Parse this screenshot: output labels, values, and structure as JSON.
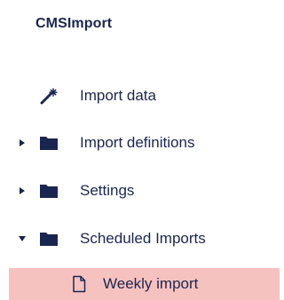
{
  "app": {
    "title": "CMSImport"
  },
  "colors": {
    "text": "#1b264f",
    "selected_background": "#f6c2c0",
    "icon": "#1b264f"
  },
  "tree": {
    "items": [
      {
        "label": "Import data",
        "icon": "magic-wand-icon",
        "expandable": false
      },
      {
        "label": "Import definitions",
        "icon": "folder-icon",
        "expandable": true,
        "expanded": false
      },
      {
        "label": "Settings",
        "icon": "folder-icon",
        "expandable": true,
        "expanded": false
      },
      {
        "label": "Scheduled Imports",
        "icon": "folder-icon",
        "expandable": true,
        "expanded": true,
        "children": [
          {
            "label": "Weekly import",
            "icon": "document-icon",
            "selected": true
          }
        ]
      }
    ]
  }
}
